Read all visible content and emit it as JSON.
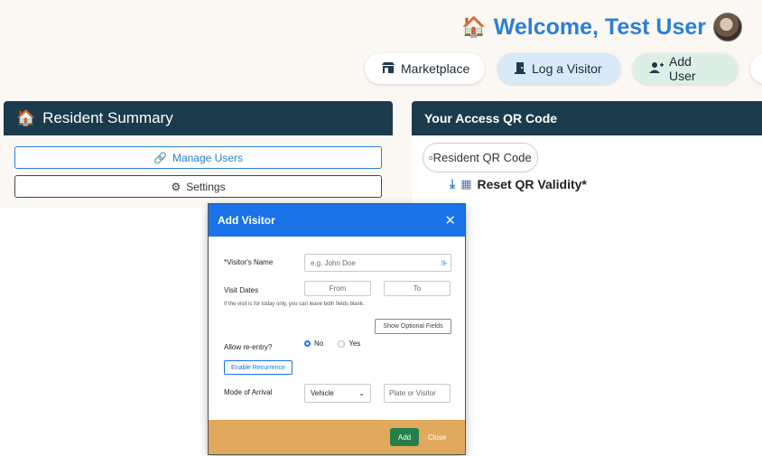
{
  "header": {
    "welcome_text": "Welcome, Test User",
    "buttons": [
      {
        "label": "Marketplace",
        "icon": "store-icon"
      },
      {
        "label": "Log a Visitor",
        "icon": "door-icon"
      },
      {
        "label": "Add User",
        "icon": "user-plus-icon"
      }
    ]
  },
  "resident_summary": {
    "title": "Resident Summary",
    "manage_users": "Manage Users",
    "settings": "Settings"
  },
  "qr_panel": {
    "title": "Your Access QR Code",
    "qr_alt": "Resident QR Code",
    "reset": "Reset QR Validity*"
  },
  "modal": {
    "title": "Add Visitor",
    "visitor_name_label": "*Visitor's Name",
    "visitor_name_placeholder": "e.g. John Doe",
    "visit_dates_label": "Visit Dates",
    "from_placeholder": "From",
    "to_placeholder": "To",
    "help_text": "If the visit is for today only, you can leave both fields blank.",
    "show_optional": "Show Optional Fields",
    "reentry_label": "Allow re-entry?",
    "reentry_options": [
      "No",
      "Yes"
    ],
    "reentry_selected": "No",
    "enable_recurrence": "Enable Recurrence",
    "mode_label": "Mode of Arrival",
    "mode_value": "Vehicle",
    "plate_placeholder": "Plate or Visitor",
    "add_button": "Add",
    "close_button": "Close"
  },
  "colors": {
    "accent": "#2b7fd6",
    "panel_header": "#1b3b4c",
    "modal_header": "#1a73e8",
    "modal_footer": "#e0a95d",
    "add_button": "#22804a"
  }
}
